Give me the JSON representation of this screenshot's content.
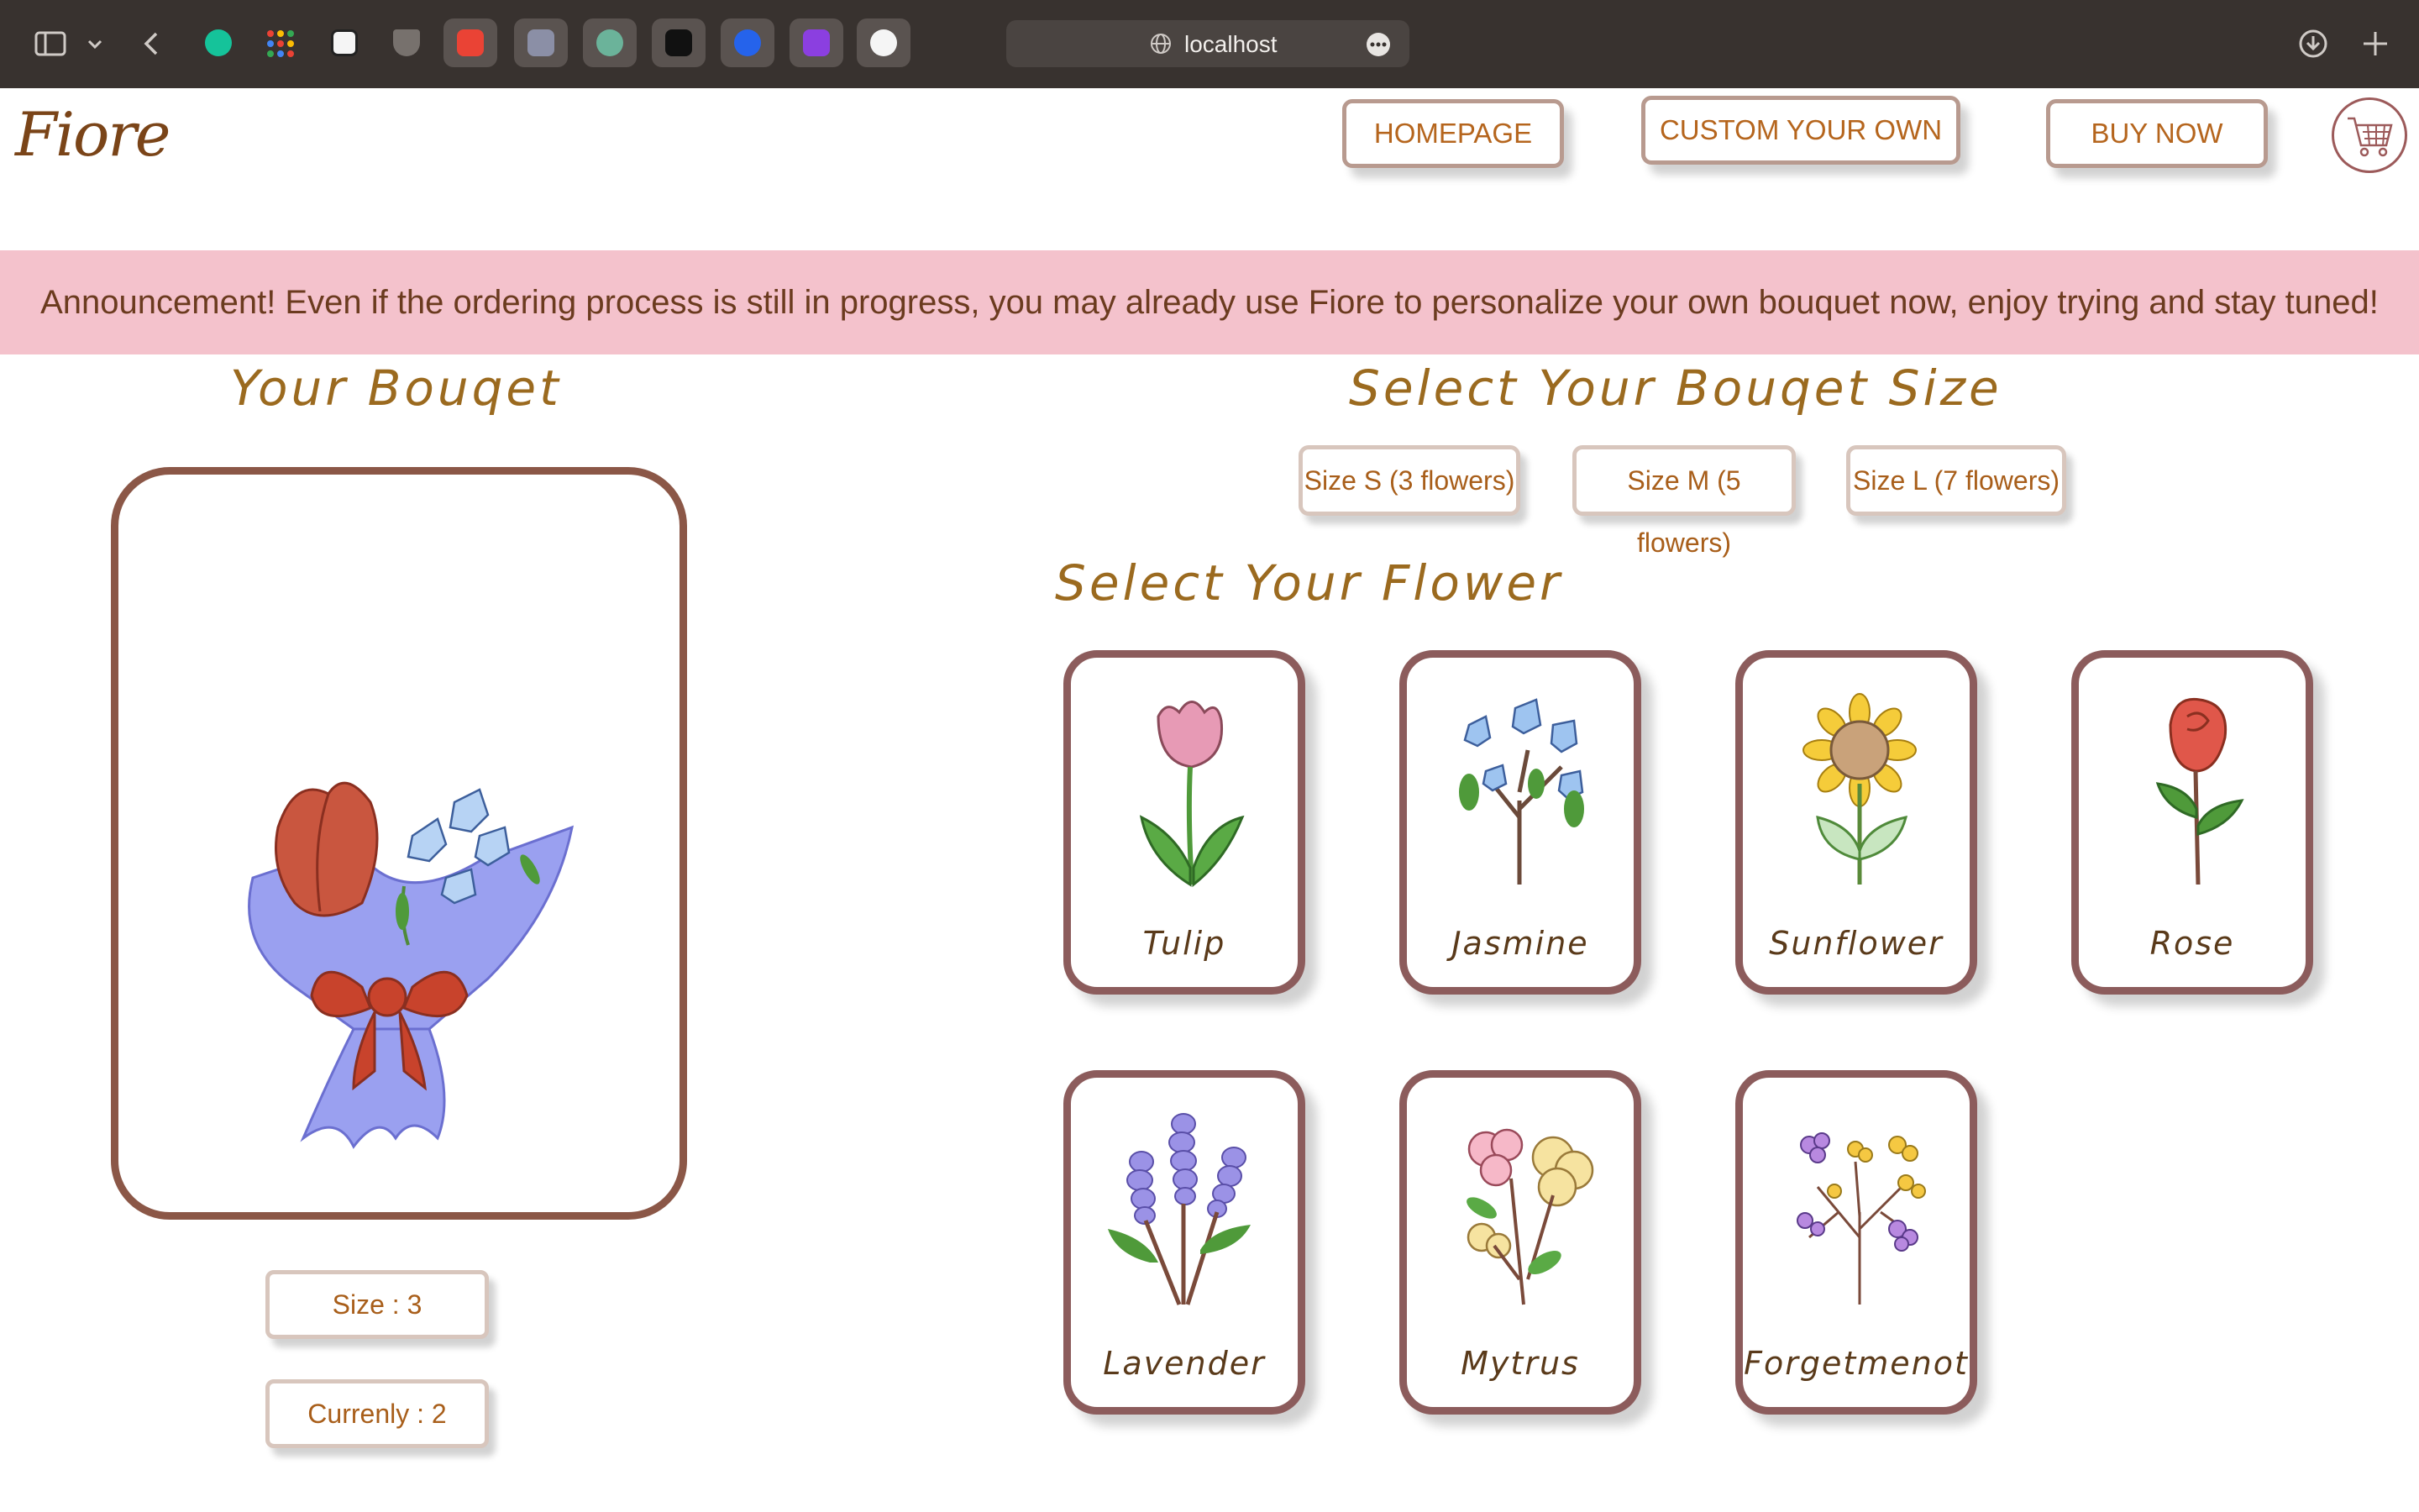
{
  "browser": {
    "url": "localhost",
    "tabs": [
      "grammarly",
      "apps",
      "notion",
      "shield",
      "gmail",
      "k-app",
      "chatgpt",
      "media",
      "c-app",
      "u-app",
      "github"
    ]
  },
  "header": {
    "logo": "Fiore",
    "nav": {
      "homepage": "HOMEPAGE",
      "custom": "CUSTOM YOUR OWN",
      "buy": "BUY NOW"
    }
  },
  "announcement": "Announcement! Even if the ordering process is still in progress, you may already use Fiore to personalize your own bouquet now, enjoy trying and stay tuned!",
  "bouquet": {
    "title": "Your Bouqet",
    "size_label": "Size : 3",
    "current_label": "Currenly : 2"
  },
  "size_section": {
    "title": "Select Your Bouqet Size",
    "options": [
      "Size S (3 flowers)",
      "Size M (5 flowers)",
      "Size L (7 flowers)"
    ]
  },
  "flower_section": {
    "title": "Select Your Flower",
    "flowers": [
      "Tulip",
      "Jasmine",
      "Sunflower",
      "Rose",
      "Lavender",
      "Mytrus",
      "Forgetmenot"
    ]
  },
  "colors": {
    "accent": "#b5651d",
    "banner": "#f4c2cc",
    "card_border": "#8c5c5c"
  }
}
